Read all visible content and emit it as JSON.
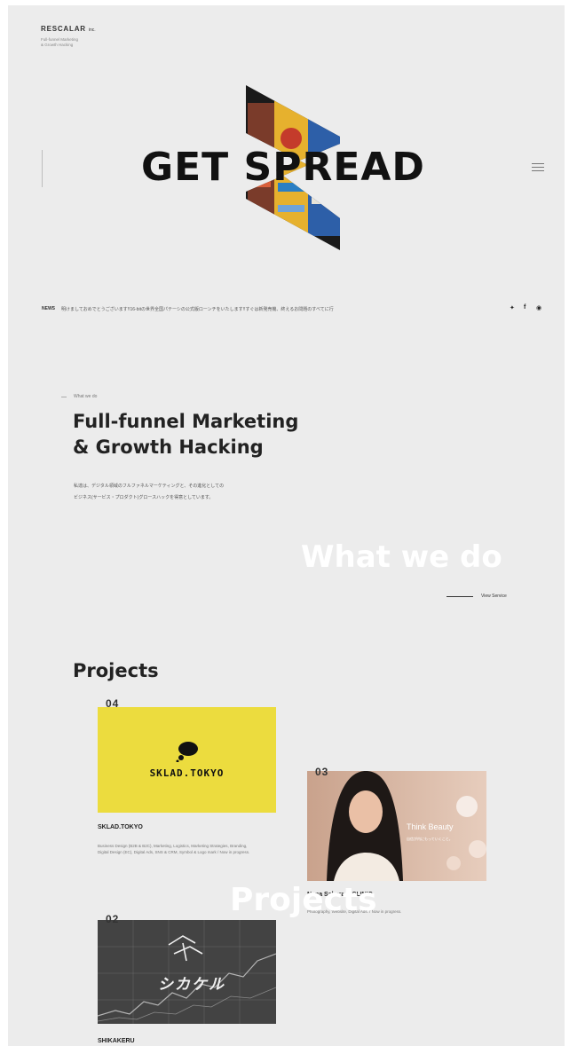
{
  "brand": {
    "logo": "RESCALAR",
    "logo_suffix": "inc.",
    "tagline_1": "Full-funnel Marketing",
    "tagline_2": "& Growth Hacking"
  },
  "hero": {
    "title": "GET SPREAD",
    "menu_icon": "hamburger-menu-icon"
  },
  "news": {
    "label": "NEWS",
    "text": "明けましておめでとうございます!!16-bitの世界全国パテーシの公式版ローンチをいたします!!すぐは新発売機、終えるお問題のすべてに行",
    "social_icons": [
      "twitter-icon",
      "facebook-icon",
      "instagram-icon"
    ]
  },
  "what_we_do": {
    "label": "What we do",
    "title_line1": "Full-funnel Marketing",
    "title_line2": "& Growth Hacking",
    "desc_line1": "私達は、デジタル領域のフルファネルマーケティングと、その進化としての",
    "desc_line2": "ビジネス(サービス・プロダクト)グロースハックを得意としています。",
    "watermark": "What we do",
    "view_link": "View Service"
  },
  "projects": {
    "title": "Projects",
    "watermark": "Projects",
    "items": [
      {
        "num": "04",
        "image_text": "SKLAD.TOKYO",
        "name": "SKLAD.TOKYO",
        "desc_line1": "Business Design (B2B & B2C), Marketing, Logistics, Marketing Strategies, Branding,",
        "desc_line2": "Digital Design (EC), Digital Ads, SNS & CRM, Symbol & Logo mark / Now in progress."
      },
      {
        "num": "03",
        "image_text": "Think Beauty",
        "image_sub": "自信が内にもっていくこと。",
        "name": "Nana Sakura × CLINIC",
        "desc_line1": "Photography, Website, Digital Ads. / Now in progress."
      },
      {
        "num": "02",
        "image_text": "シカケル",
        "name": "SHIKAKERU"
      }
    ]
  },
  "colors": {
    "page_bg": "#ececec",
    "sklad_yellow": "#ecdc3e",
    "shika_dark": "#434343"
  }
}
